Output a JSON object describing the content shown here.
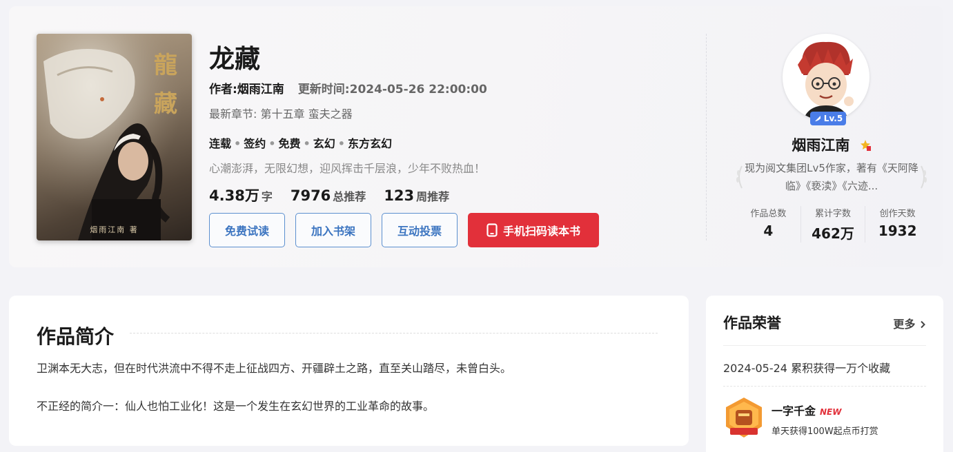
{
  "book": {
    "title": "龙藏",
    "cover_title": "龍藏",
    "cover_author": "烟雨江南 著",
    "author_line": "作者:烟雨江南",
    "update_line": "更新时间:2024-05-26 22:00:00",
    "latest_chapter": "最新章节: 第十五章 蛮夫之器",
    "tags": [
      "连载",
      "签约",
      "免费",
      "玄幻",
      "东方玄幻"
    ],
    "slogan": "心潮澎湃，无限幻想，迎风挥击千层浪，少年不败热血！",
    "stats": [
      {
        "num": "4.38万",
        "unit": "字"
      },
      {
        "num": "7976",
        "unit": "总推荐"
      },
      {
        "num": "123",
        "unit": "周推荐"
      }
    ]
  },
  "buttons": {
    "free_read": "免费试读",
    "add_shelf": "加入书架",
    "vote": "互动投票",
    "scan": "手机扫码读本书"
  },
  "author": {
    "level": "Lv.5",
    "name": "烟雨江南",
    "desc": "现为阅文集团Lv5作家，著有《天阿降临》《亵渎》《六迹...",
    "stats": [
      {
        "label": "作品总数",
        "value": "4"
      },
      {
        "label": "累计字数",
        "value": "462万"
      },
      {
        "label": "创作天数",
        "value": "1932"
      }
    ]
  },
  "intro": {
    "title": "作品简介",
    "p1": "卫渊本无大志，但在时代洪流中不得不走上征战四方、开疆辟土之路，直至关山踏尽，未曾白头。",
    "p2": "不正经的简介一：仙人也怕工业化！这是一个发生在玄幻世界的工业革命的故事。"
  },
  "honor": {
    "title": "作品荣誉",
    "more": "更多",
    "item": "2024-05-24 累积获得一万个收藏",
    "badge_name": "一字千金",
    "badge_new": "NEW",
    "badge_desc": "单天获得100W起点币打赏"
  },
  "colors": {
    "accent_blue": "#3b74c0",
    "scan_red": "#e2303a",
    "level_blue": "#4a7de8"
  }
}
